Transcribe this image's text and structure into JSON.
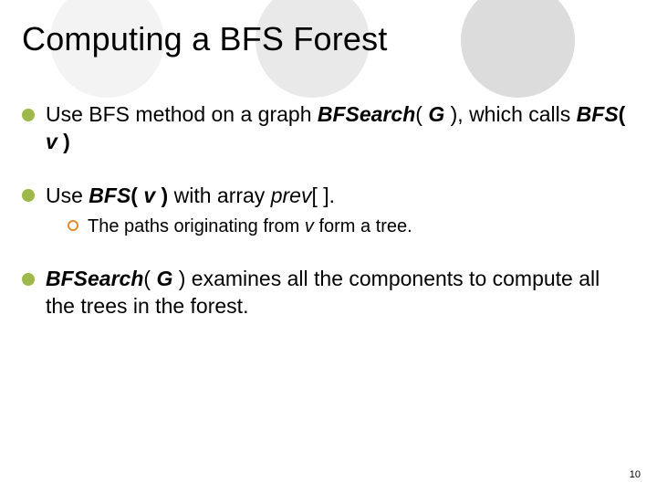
{
  "title": "Computing a BFS Forest",
  "bullets": {
    "b1": {
      "pre": "Use BFS method on a graph ",
      "fn": "BFSearch",
      "paren_open": "( ",
      "arg": "G",
      "paren_close_comma": " ), ",
      "line2a": "which calls ",
      "bfs": "BFS",
      "paren_open2": "( ",
      "v": "v",
      "paren_close2": " )"
    },
    "b2": {
      "pre": "Use ",
      "bfs": "BFS",
      "paren_open": "( ",
      "v": "v",
      "paren_close": " )",
      "with": " with array ",
      "prev": "prev",
      "brackets": "[ ].",
      "sub": {
        "a": "The paths originating from ",
        "v": "v",
        "b": " form a tree."
      }
    },
    "b3": {
      "fn": "BFSearch",
      "paren_open": "( ",
      "arg": "G",
      "paren_close": " )",
      "rest": " examines all the components to compute all the trees in the forest."
    }
  },
  "pagenum": "10"
}
